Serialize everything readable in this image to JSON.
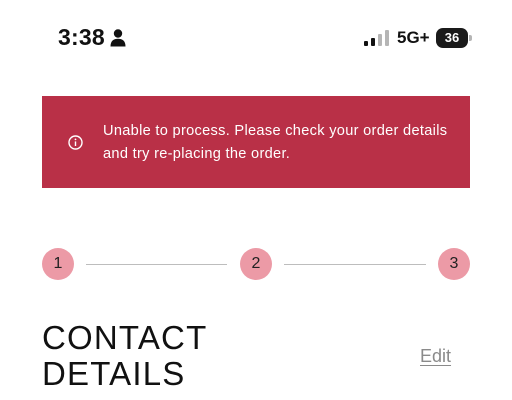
{
  "status_bar": {
    "time": "3:38",
    "network": "5G+",
    "battery": "36",
    "icons": [
      "person-icon",
      "signal-icon",
      "battery-icon"
    ]
  },
  "alert": {
    "message": "Unable to process. Please check your order details and try re-placing the order.",
    "icon": "info-icon",
    "background_color": "#b93047"
  },
  "stepper": {
    "steps": [
      "1",
      "2",
      "3"
    ],
    "step_color": "#ec9aa6"
  },
  "section": {
    "title": "CONTACT DETAILS",
    "edit_label": "Edit"
  }
}
